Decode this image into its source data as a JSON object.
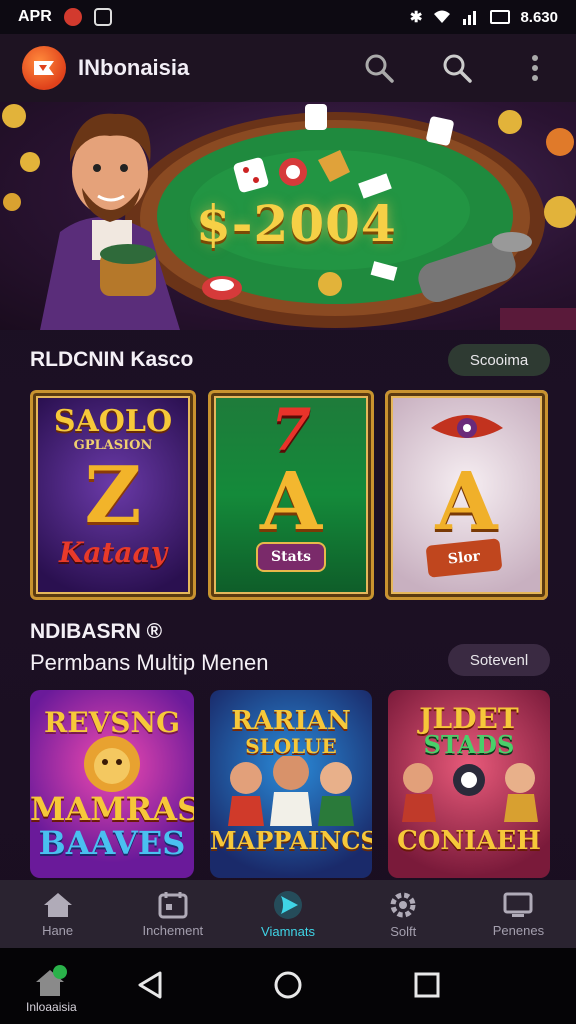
{
  "status_bar": {
    "carrier": "APR",
    "time": "8.630"
  },
  "app_bar": {
    "title": "INbonaisia"
  },
  "hero": {
    "jackpot": "$-2004"
  },
  "section1": {
    "title": "RLDCNIN Kasco",
    "pill": "Scooima",
    "cards": [
      {
        "top": "SAOLO",
        "sub": "GPLASION",
        "big": "Z",
        "bottom": "Kataay"
      },
      {
        "top": "7",
        "big": "A",
        "bottom": "Stats"
      },
      {
        "top": "",
        "big": "A",
        "bottom": "Slor"
      }
    ]
  },
  "section2": {
    "title_line1": "NDIBASRN ®",
    "title_line2": "Permbans Multip Menen",
    "pill": "Sotevenl",
    "cards": [
      {
        "top": "REVSNG",
        "big": "MAMRAS",
        "bottom": "BAAVES"
      },
      {
        "top": "RARIAN",
        "sub": "SLOLUE",
        "bottom": "MAPPAINCS"
      },
      {
        "top": "JLDET",
        "sub": "STADS",
        "bottom": "CONIAEH"
      }
    ]
  },
  "bottom_nav": [
    {
      "label": "Hane",
      "icon": "home-icon",
      "active": false
    },
    {
      "label": "Inchement",
      "icon": "calendar-icon",
      "active": false
    },
    {
      "label": "Viamnats",
      "icon": "play-icon",
      "active": true
    },
    {
      "label": "Solft",
      "icon": "gear-icon",
      "active": false
    },
    {
      "label": "Penenes",
      "icon": "monitor-icon",
      "active": false
    }
  ],
  "system_nav": {
    "home_app_label": "Inloaaisia"
  },
  "colors": {
    "accent": "#3fd4e6",
    "gold": "#f6d046",
    "brand": "#e8501f"
  }
}
